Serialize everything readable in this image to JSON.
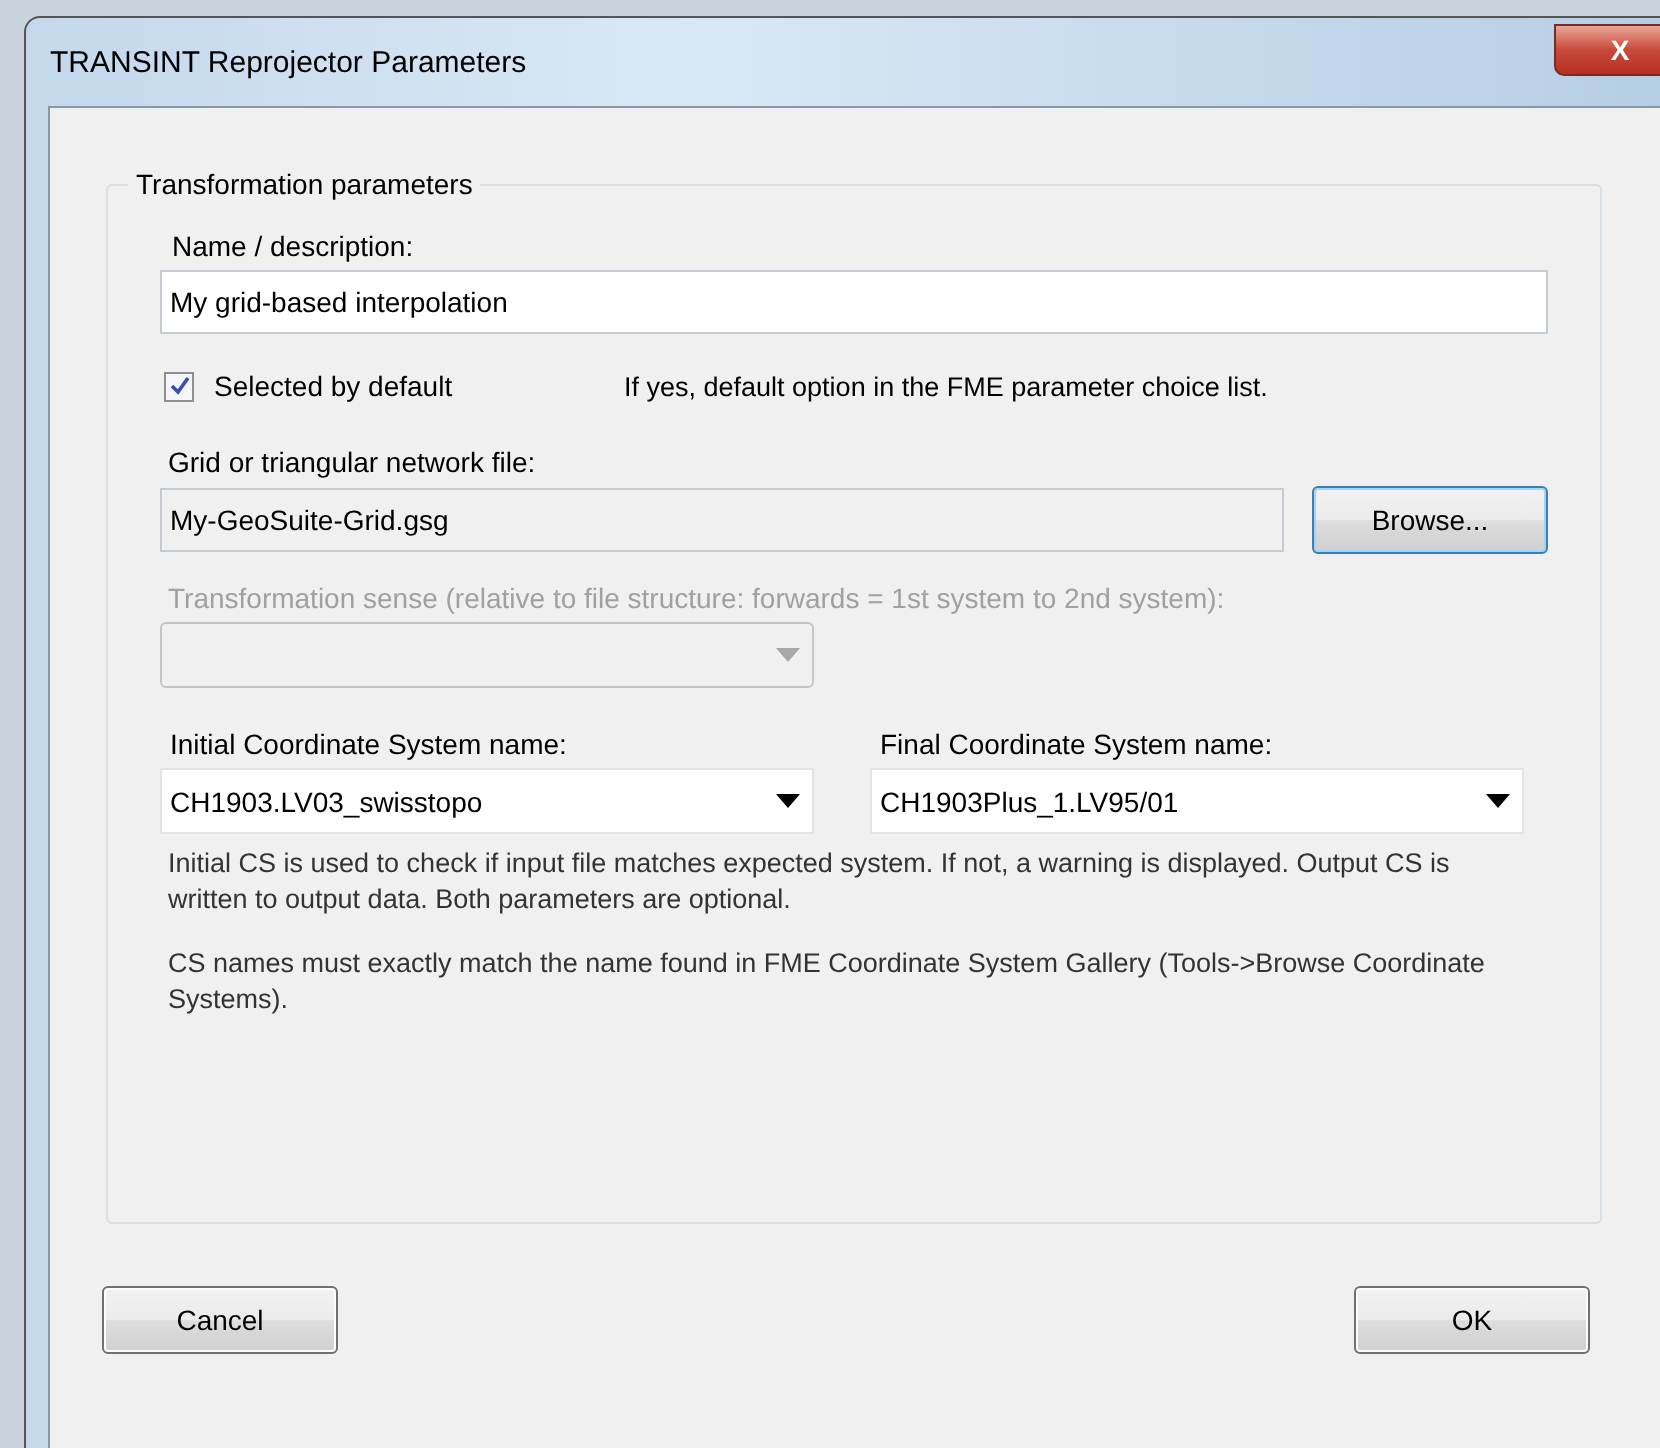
{
  "window": {
    "title": "TRANSINT Reprojector Parameters",
    "close": "X"
  },
  "group": {
    "title": "Transformation parameters",
    "name_label": "Name / description:",
    "name_value": "My grid-based interpolation",
    "selected_default": {
      "label": "Selected by default",
      "checked": true,
      "hint": "If yes, default option in the FME parameter choice list."
    },
    "file_label": "Grid or triangular network file:",
    "file_value": "My-GeoSuite-Grid.gsg",
    "browse": "Browse...",
    "sense": {
      "label": "Transformation sense (relative to file structure: forwards = 1st system to 2nd system):",
      "disabled": true
    },
    "initial": {
      "label": "Initial Coordinate System name:",
      "value": "CH1903.LV03_swisstopo"
    },
    "final": {
      "label": "Final Coordinate System name:",
      "value": "CH1903Plus_1.LV95/01"
    },
    "notes": [
      "Initial CS is used to check if input file matches expected system. If not, a warning is displayed. Output CS is written to output data. Both parameters are optional.",
      "CS names must exactly match the name found in FME Coordinate System Gallery (Tools->Browse Coordinate Systems)."
    ]
  },
  "buttons": [
    "Cancel",
    "OK"
  ]
}
